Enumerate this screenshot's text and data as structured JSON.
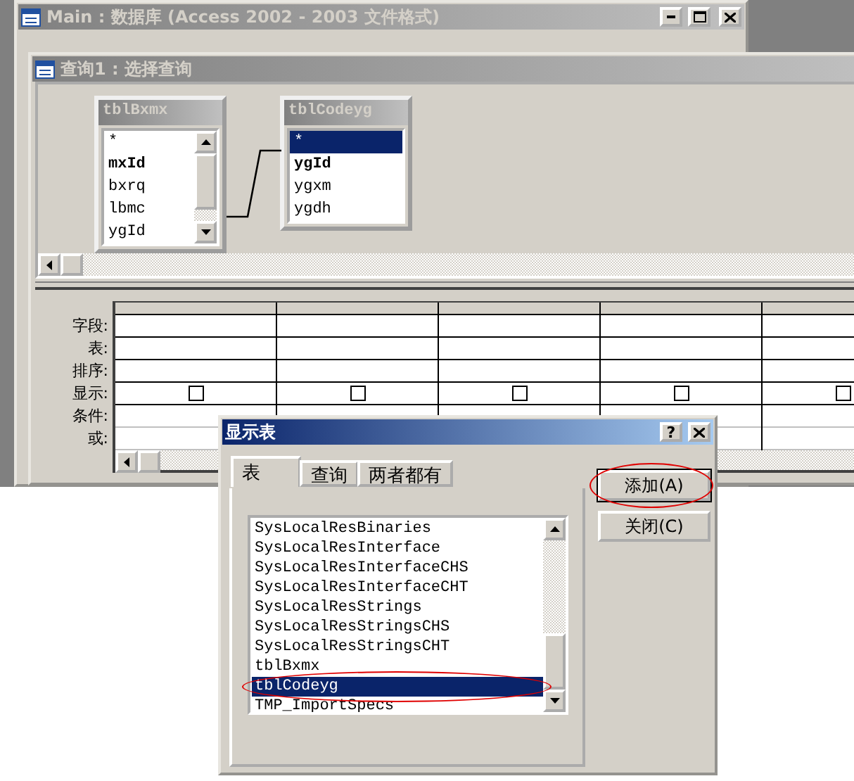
{
  "main_window": {
    "title": "Main : 数据库 (Access 2002 - 2003 文件格式)",
    "active": false
  },
  "query_window": {
    "title": "查询1 : 选择查询",
    "active": false,
    "tables": [
      {
        "name": "tblBxmx",
        "fields": [
          {
            "name": "*",
            "key": false,
            "selected": false
          },
          {
            "name": "mxId",
            "key": true,
            "selected": false
          },
          {
            "name": "bxrq",
            "key": false,
            "selected": false
          },
          {
            "name": "lbmc",
            "key": false,
            "selected": false
          },
          {
            "name": "ygId",
            "key": false,
            "selected": false
          }
        ]
      },
      {
        "name": "tblCodeyg",
        "fields": [
          {
            "name": "*",
            "key": false,
            "selected": true
          },
          {
            "name": "ygId",
            "key": true,
            "selected": false
          },
          {
            "name": "ygxm",
            "key": false,
            "selected": false
          },
          {
            "name": "ygdh",
            "key": false,
            "selected": false
          }
        ]
      }
    ],
    "grid": {
      "row_labels": [
        "字段:",
        "表:",
        "排序:",
        "显示:",
        "条件:",
        "或:"
      ],
      "columns": [
        {
          "show": false
        },
        {
          "show": false
        },
        {
          "show": false
        },
        {
          "show": false
        },
        {
          "show": false
        }
      ]
    }
  },
  "dialog": {
    "title": "显示表",
    "help": "?",
    "tabs": [
      {
        "label": "表",
        "selected": true
      },
      {
        "label": "查询",
        "selected": false
      },
      {
        "label": "两者都有",
        "selected": false
      }
    ],
    "items": [
      {
        "label": "SysLocalResBinaries",
        "selected": false,
        "annotated": false
      },
      {
        "label": "SysLocalResInterface",
        "selected": false,
        "annotated": false
      },
      {
        "label": "SysLocalResInterfaceCHS",
        "selected": false,
        "annotated": false
      },
      {
        "label": "SysLocalResInterfaceCHT",
        "selected": false,
        "annotated": false
      },
      {
        "label": "SysLocalResStrings",
        "selected": false,
        "annotated": false
      },
      {
        "label": "SysLocalResStringsCHS",
        "selected": false,
        "annotated": false
      },
      {
        "label": "SysLocalResStringsCHT",
        "selected": false,
        "annotated": false
      },
      {
        "label": "tblBxmx",
        "selected": false,
        "annotated": false
      },
      {
        "label": "tblCodeyg",
        "selected": true,
        "annotated": true
      },
      {
        "label": "TMP_ImportSpecs",
        "selected": false,
        "annotated": false
      }
    ],
    "buttons": [
      {
        "label": "添加(A)",
        "focused": true,
        "annotated": true
      },
      {
        "label": "关闭(C)",
        "focused": false,
        "annotated": false
      }
    ]
  }
}
